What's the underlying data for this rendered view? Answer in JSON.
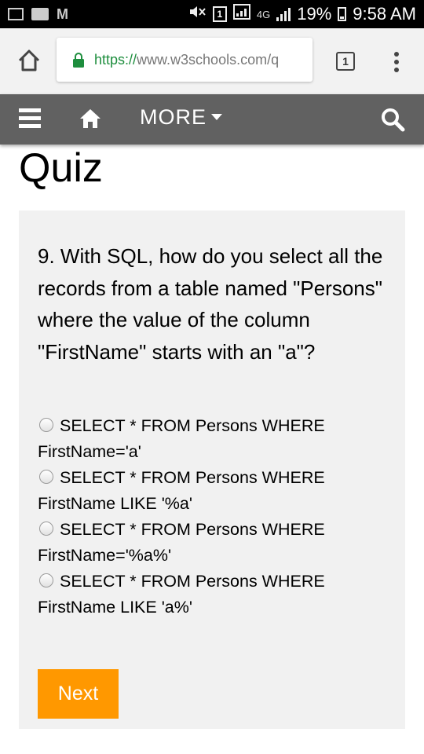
{
  "status_bar": {
    "network": "4G",
    "sim": "1",
    "battery": "19%",
    "time": "9:58 AM"
  },
  "browser": {
    "url_scheme": "https://",
    "url_host": "www.w3schools.com/q",
    "tab_count": "1",
    "icons": [
      "home-icon",
      "lock-icon",
      "tabs-icon",
      "overflow-menu-icon"
    ]
  },
  "site_nav": {
    "more_label": "MORE",
    "icons": [
      "hamburger-icon",
      "home-icon",
      "search-icon"
    ]
  },
  "page": {
    "title": "Quiz"
  },
  "quiz": {
    "question": "9. With SQL, how do you select all the records from a table named \"Persons\" where the value of the column \"FirstName\" starts with an \"a\"?",
    "options": [
      {
        "line1": "SELECT * FROM Persons WHERE",
        "line2": "FirstName='a'"
      },
      {
        "line1": "SELECT * FROM Persons WHERE",
        "line2": "FirstName LIKE '%a'"
      },
      {
        "line1": "SELECT * FROM Persons WHERE",
        "line2": "FirstName='%a%'"
      },
      {
        "line1": "SELECT * FROM Persons WHERE",
        "line2": "FirstName LIKE 'a%'"
      }
    ],
    "next_label": "Next"
  },
  "colors": {
    "nav_bg": "#616161",
    "panel_bg": "#f1f1f1",
    "next_button": "#ff9800",
    "url_green": "#1e8e3e"
  }
}
